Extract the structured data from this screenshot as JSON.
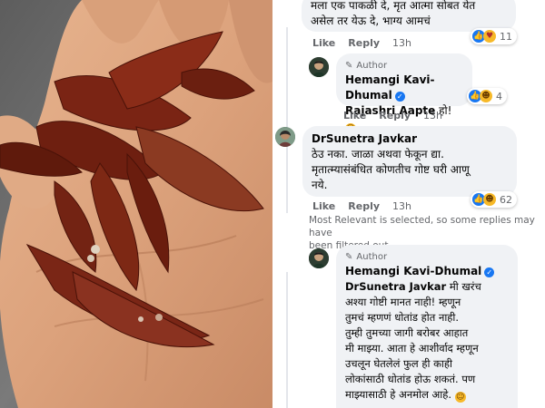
{
  "comments": [
    {
      "lines": [
        "मला एक पाकळी दे, मृत आत्मा सोबत येत",
        "असेल तर येऊ दे, भाग्य आमचं"
      ],
      "actions": [
        "Like",
        "Reply",
        "13h"
      ],
      "reaction_count": "11"
    },
    {
      "author_badge": "Author",
      "name": "Hemangi Kavi-Dhumal",
      "mention": "Rajashri Aapte",
      "text": " हो!",
      "actions": [
        "Like",
        "Reply",
        "13h"
      ],
      "reaction_count": "4"
    },
    {
      "name": "DrSunetra Javkar",
      "lines": [
        "ठेउ नका. जाळा अथवा फेकून द्या.",
        "मृतात्म्यासंबंधित कोणतीच गोष्ट घरी आणू",
        "नये."
      ],
      "actions": [
        "Like",
        "Reply",
        "13h"
      ],
      "reaction_count": "62"
    },
    {
      "author_badge": "Author",
      "name": "Hemangi Kavi-Dhumal",
      "mention": "DrSunetra Javkar",
      "first_line_rest": " मी खरंच",
      "lines": [
        "अश्या गोष्टी मानत नाही! म्हणून",
        "तुमचं म्हणणं धोतांड होत नाही.",
        "तुम्ही तुमच्या जागी बरोबर आहात",
        "मी माझ्या. आता हे आशीर्वाद म्हणून",
        "उचलून घेतलेलं फुल ही काही",
        "लोकांसाठी धोतांड होऊ शकतं. पण",
        "माझ्यासाठी हे अनमोल आहे."
      ]
    }
  ],
  "filter_note": [
    "Most Relevant is selected, so some replies may have",
    "been filtered out."
  ],
  "colors": {
    "bubble": "#f0f2f5",
    "link": "#1877f2",
    "meta": "#65676b"
  }
}
